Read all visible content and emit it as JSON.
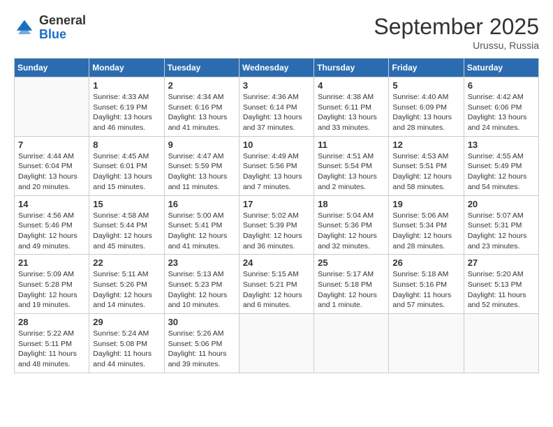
{
  "header": {
    "logo_line1": "General",
    "logo_line2": "Blue",
    "month": "September 2025",
    "location": "Urussu, Russia"
  },
  "weekdays": [
    "Sunday",
    "Monday",
    "Tuesday",
    "Wednesday",
    "Thursday",
    "Friday",
    "Saturday"
  ],
  "weeks": [
    [
      {
        "day": "",
        "info": ""
      },
      {
        "day": "1",
        "info": "Sunrise: 4:33 AM\nSunset: 6:19 PM\nDaylight: 13 hours\nand 46 minutes."
      },
      {
        "day": "2",
        "info": "Sunrise: 4:34 AM\nSunset: 6:16 PM\nDaylight: 13 hours\nand 41 minutes."
      },
      {
        "day": "3",
        "info": "Sunrise: 4:36 AM\nSunset: 6:14 PM\nDaylight: 13 hours\nand 37 minutes."
      },
      {
        "day": "4",
        "info": "Sunrise: 4:38 AM\nSunset: 6:11 PM\nDaylight: 13 hours\nand 33 minutes."
      },
      {
        "day": "5",
        "info": "Sunrise: 4:40 AM\nSunset: 6:09 PM\nDaylight: 13 hours\nand 28 minutes."
      },
      {
        "day": "6",
        "info": "Sunrise: 4:42 AM\nSunset: 6:06 PM\nDaylight: 13 hours\nand 24 minutes."
      }
    ],
    [
      {
        "day": "7",
        "info": "Sunrise: 4:44 AM\nSunset: 6:04 PM\nDaylight: 13 hours\nand 20 minutes."
      },
      {
        "day": "8",
        "info": "Sunrise: 4:45 AM\nSunset: 6:01 PM\nDaylight: 13 hours\nand 15 minutes."
      },
      {
        "day": "9",
        "info": "Sunrise: 4:47 AM\nSunset: 5:59 PM\nDaylight: 13 hours\nand 11 minutes."
      },
      {
        "day": "10",
        "info": "Sunrise: 4:49 AM\nSunset: 5:56 PM\nDaylight: 13 hours\nand 7 minutes."
      },
      {
        "day": "11",
        "info": "Sunrise: 4:51 AM\nSunset: 5:54 PM\nDaylight: 13 hours\nand 2 minutes."
      },
      {
        "day": "12",
        "info": "Sunrise: 4:53 AM\nSunset: 5:51 PM\nDaylight: 12 hours\nand 58 minutes."
      },
      {
        "day": "13",
        "info": "Sunrise: 4:55 AM\nSunset: 5:49 PM\nDaylight: 12 hours\nand 54 minutes."
      }
    ],
    [
      {
        "day": "14",
        "info": "Sunrise: 4:56 AM\nSunset: 5:46 PM\nDaylight: 12 hours\nand 49 minutes."
      },
      {
        "day": "15",
        "info": "Sunrise: 4:58 AM\nSunset: 5:44 PM\nDaylight: 12 hours\nand 45 minutes."
      },
      {
        "day": "16",
        "info": "Sunrise: 5:00 AM\nSunset: 5:41 PM\nDaylight: 12 hours\nand 41 minutes."
      },
      {
        "day": "17",
        "info": "Sunrise: 5:02 AM\nSunset: 5:39 PM\nDaylight: 12 hours\nand 36 minutes."
      },
      {
        "day": "18",
        "info": "Sunrise: 5:04 AM\nSunset: 5:36 PM\nDaylight: 12 hours\nand 32 minutes."
      },
      {
        "day": "19",
        "info": "Sunrise: 5:06 AM\nSunset: 5:34 PM\nDaylight: 12 hours\nand 28 minutes."
      },
      {
        "day": "20",
        "info": "Sunrise: 5:07 AM\nSunset: 5:31 PM\nDaylight: 12 hours\nand 23 minutes."
      }
    ],
    [
      {
        "day": "21",
        "info": "Sunrise: 5:09 AM\nSunset: 5:28 PM\nDaylight: 12 hours\nand 19 minutes."
      },
      {
        "day": "22",
        "info": "Sunrise: 5:11 AM\nSunset: 5:26 PM\nDaylight: 12 hours\nand 14 minutes."
      },
      {
        "day": "23",
        "info": "Sunrise: 5:13 AM\nSunset: 5:23 PM\nDaylight: 12 hours\nand 10 minutes."
      },
      {
        "day": "24",
        "info": "Sunrise: 5:15 AM\nSunset: 5:21 PM\nDaylight: 12 hours\nand 6 minutes."
      },
      {
        "day": "25",
        "info": "Sunrise: 5:17 AM\nSunset: 5:18 PM\nDaylight: 12 hours\nand 1 minute."
      },
      {
        "day": "26",
        "info": "Sunrise: 5:18 AM\nSunset: 5:16 PM\nDaylight: 11 hours\nand 57 minutes."
      },
      {
        "day": "27",
        "info": "Sunrise: 5:20 AM\nSunset: 5:13 PM\nDaylight: 11 hours\nand 52 minutes."
      }
    ],
    [
      {
        "day": "28",
        "info": "Sunrise: 5:22 AM\nSunset: 5:11 PM\nDaylight: 11 hours\nand 48 minutes."
      },
      {
        "day": "29",
        "info": "Sunrise: 5:24 AM\nSunset: 5:08 PM\nDaylight: 11 hours\nand 44 minutes."
      },
      {
        "day": "30",
        "info": "Sunrise: 5:26 AM\nSunset: 5:06 PM\nDaylight: 11 hours\nand 39 minutes."
      },
      {
        "day": "",
        "info": ""
      },
      {
        "day": "",
        "info": ""
      },
      {
        "day": "",
        "info": ""
      },
      {
        "day": "",
        "info": ""
      }
    ]
  ]
}
